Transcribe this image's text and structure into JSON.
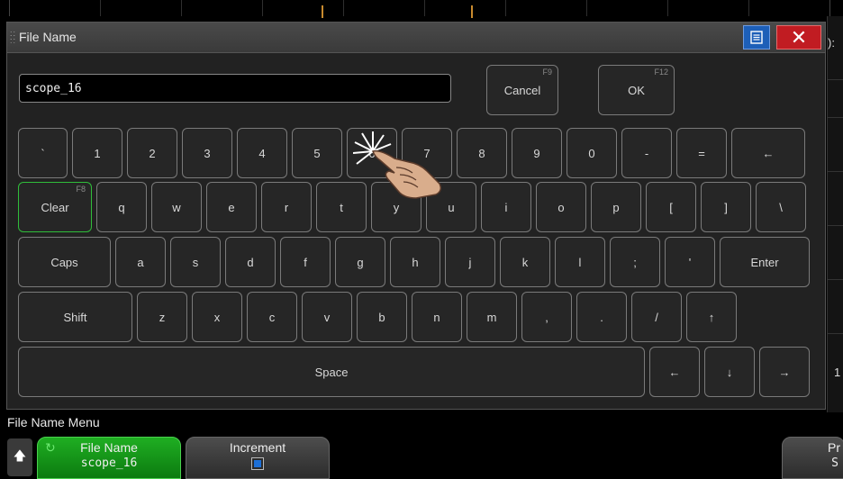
{
  "dialog": {
    "title": "File Name",
    "filename_value": "scope_16",
    "cancel": {
      "label": "Cancel",
      "hint": "F9"
    },
    "ok": {
      "label": "OK",
      "hint": "F12"
    }
  },
  "keyboard": {
    "row1": [
      "`",
      "1",
      "2",
      "3",
      "4",
      "5",
      "6",
      "7",
      "8",
      "9",
      "0",
      "-",
      "=",
      "←"
    ],
    "row2": [
      "Clear",
      "q",
      "w",
      "e",
      "r",
      "t",
      "y",
      "u",
      "i",
      "o",
      "p",
      "[",
      "]",
      "\\"
    ],
    "clear_hint": "F8",
    "row3": [
      "Caps",
      "a",
      "s",
      "d",
      "f",
      "g",
      "h",
      "j",
      "k",
      "l",
      ";",
      "'",
      "Enter"
    ],
    "row4": [
      "Shift",
      "z",
      "x",
      "c",
      "v",
      "b",
      "n",
      "m",
      ",",
      ".",
      "/",
      "↑"
    ],
    "row5": [
      "Space",
      "←",
      "↓",
      "→"
    ]
  },
  "menu": {
    "title": "File Name Menu",
    "softkeys": {
      "file_name": {
        "title": "File Name",
        "value": "scope_16"
      },
      "increment": {
        "title": "Increment",
        "checked": true
      },
      "right": {
        "title": "Pr",
        "value": "S"
      }
    }
  },
  "side": {
    "colon": "):",
    "one": "1"
  },
  "colors": {
    "accent_green": "#1fae22",
    "close_red": "#c11c22",
    "menu_blue": "#1d5fb8"
  }
}
